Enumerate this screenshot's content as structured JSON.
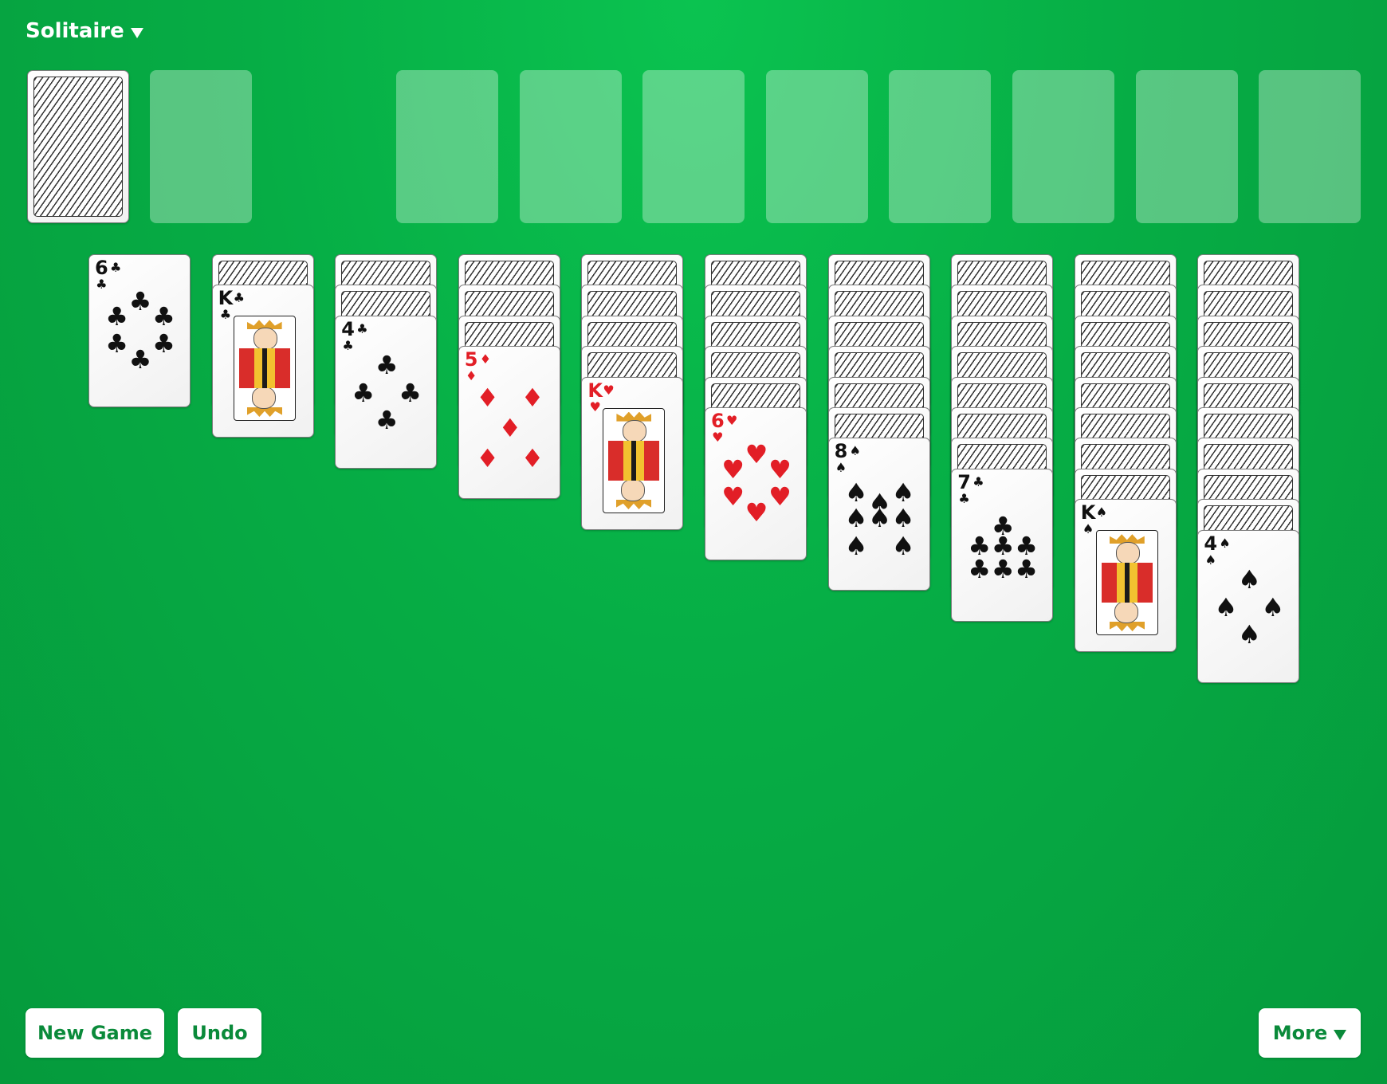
{
  "header": {
    "title": "Solitaire"
  },
  "buttons": {
    "new_game": "New Game",
    "undo": "Undo",
    "more": "More"
  },
  "colors": {
    "table": "#06ad45",
    "button_text": "#0a8a3a",
    "red_suit": "#e21e26"
  },
  "stock": {
    "face_down": true
  },
  "foundations": {
    "count": 8
  },
  "tableau": [
    {
      "face_down": 0,
      "face_up": [
        {
          "rank": "6",
          "suit": "clubs"
        }
      ]
    },
    {
      "face_down": 1,
      "face_up": [
        {
          "rank": "K",
          "suit": "clubs"
        }
      ]
    },
    {
      "face_down": 2,
      "face_up": [
        {
          "rank": "4",
          "suit": "clubs"
        }
      ]
    },
    {
      "face_down": 3,
      "face_up": [
        {
          "rank": "5",
          "suit": "diamonds"
        }
      ]
    },
    {
      "face_down": 4,
      "face_up": [
        {
          "rank": "K",
          "suit": "hearts"
        }
      ]
    },
    {
      "face_down": 5,
      "face_up": [
        {
          "rank": "6",
          "suit": "hearts"
        }
      ]
    },
    {
      "face_down": 6,
      "face_up": [
        {
          "rank": "8",
          "suit": "spades"
        }
      ]
    },
    {
      "face_down": 7,
      "face_up": [
        {
          "rank": "7",
          "suit": "clubs"
        }
      ]
    },
    {
      "face_down": 8,
      "face_up": [
        {
          "rank": "K",
          "suit": "spades"
        }
      ]
    },
    {
      "face_down": 9,
      "face_up": [
        {
          "rank": "4",
          "suit": "spades"
        }
      ]
    }
  ]
}
